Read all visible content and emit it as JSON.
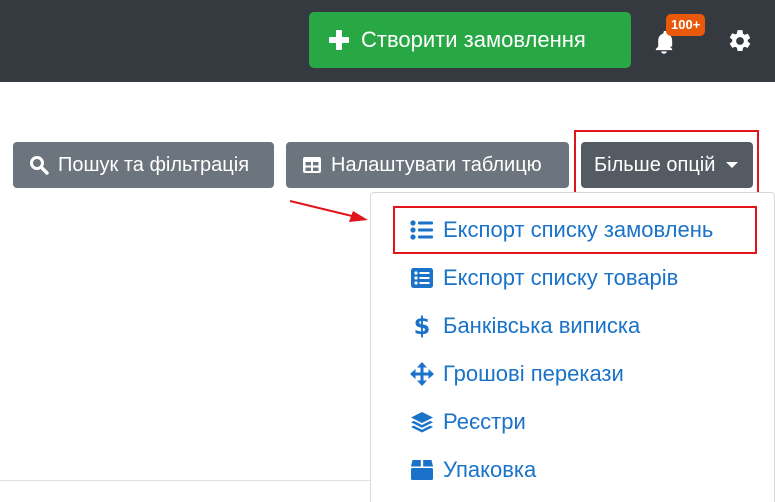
{
  "header": {
    "create_order_label": "Створити замовлення",
    "notification_badge": "100+",
    "colors": {
      "bar": "#343a40",
      "create": "#28a745",
      "badge": "#e8590c"
    }
  },
  "toolbar": {
    "search_filter_label": "Пошук та фільтрація",
    "configure_table_label": "Налаштувати таблицю",
    "more_options_label": "Більше опцій"
  },
  "dropdown": {
    "items": [
      {
        "label": "Експорт списку замовлень",
        "icon": "list-ul-icon"
      },
      {
        "label": "Експорт списку товарів",
        "icon": "list-alt-icon"
      },
      {
        "label": "Банківська виписка",
        "icon": "dollar-icon"
      },
      {
        "label": "Грошові перекази",
        "icon": "arrows-move-icon"
      },
      {
        "label": "Реєстри",
        "icon": "layers-icon"
      },
      {
        "label": "Упаковка",
        "icon": "box-icon"
      }
    ],
    "colors": {
      "link": "#1a73c8",
      "highlight": "#e0141a"
    }
  }
}
